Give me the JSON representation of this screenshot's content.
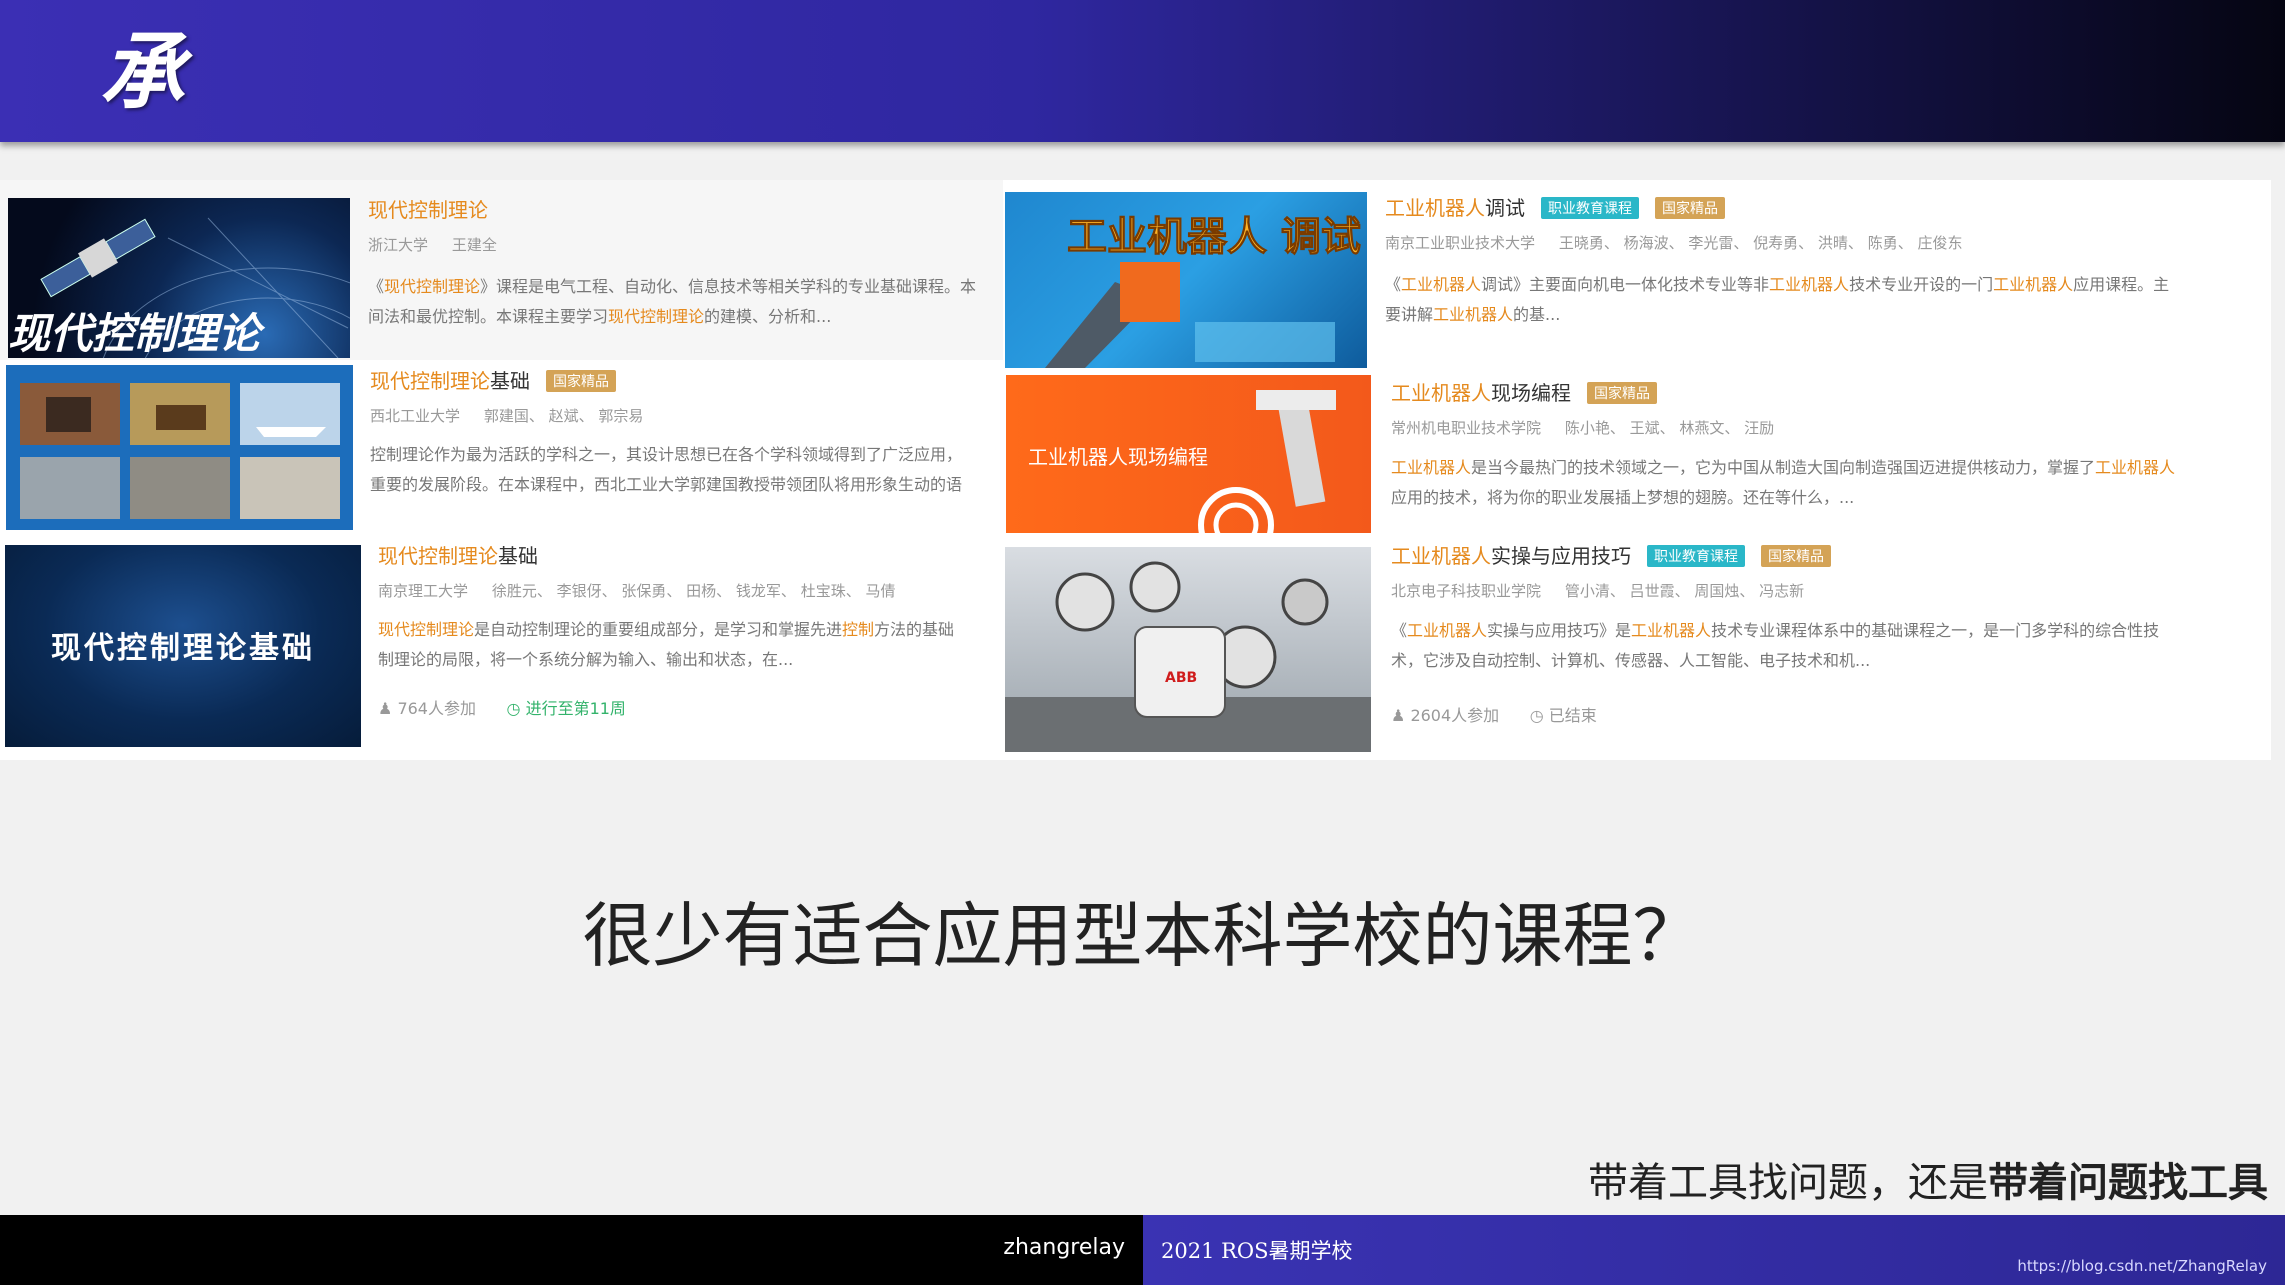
{
  "header": {
    "title": "承"
  },
  "courses_left": [
    {
      "title_hl": "现代控制理论",
      "title_rest": "",
      "tags": [],
      "school": "浙江大学",
      "teachers": "王建全",
      "desc": [
        {
          "t": "《"
        },
        {
          "t": "现代控制理论",
          "h": true
        },
        {
          "t": "》课程是电气工程、自动化、信息技术等相关学科的专业基础课程。本"
        },
        {
          "t": "\n"
        },
        {
          "t": "间法和最优控制。本课程主要学习"
        },
        {
          "t": "现代控制理论",
          "h": true
        },
        {
          "t": "的建模、分析和..."
        }
      ],
      "thumb_text": "现代控制理论"
    },
    {
      "title_hl": "现代控制理论",
      "title_rest": "基础",
      "tags": [
        "国家精品"
      ],
      "school": "西北工业大学",
      "teachers": "郭建国、 赵斌、 郭宗易",
      "desc": [
        {
          "t": "控制理论作为最为活跃的学科之一，其设计思想已在各个学科领域得到了广泛应用，"
        },
        {
          "t": "\n"
        },
        {
          "t": "重要的发展阶段。在本课程中，西北工业大学郭建国教授带领团队将用形象生动的语"
        }
      ]
    },
    {
      "title_hl": "现代控制理论",
      "title_rest": "基础",
      "tags": [],
      "school": "南京理工大学",
      "teachers": "徐胜元、 李银伢、 张保勇、 田杨、 钱龙军、 杜宝珠、 马倩",
      "desc": [
        {
          "t": "现代控制理论",
          "h": true
        },
        {
          "t": "是自动控制理论的重要组成部分，是学习和掌握先进"
        },
        {
          "t": "控制",
          "h": true
        },
        {
          "t": "方法的基础"
        },
        {
          "t": "\n"
        },
        {
          "t": "制理论的局限，将一个系统分解为输入、输出和状态，在..."
        }
      ],
      "thumb_text": "现代控制理论基础",
      "participants": "764人参加",
      "status": "进行至第11周"
    }
  ],
  "courses_right": [
    {
      "title_hl": "工业机器人",
      "title_rest": "调试",
      "tags": [
        "职业教育课程",
        "国家精品"
      ],
      "school": "南京工业职业技术大学",
      "teachers": "王晓勇、 杨海波、 李光雷、 倪寿勇、 洪晴、 陈勇、 庄俊东",
      "desc": [
        {
          "t": "《"
        },
        {
          "t": "工业机器人",
          "h": true
        },
        {
          "t": "调试》主要面向机电一体化技术专业等非"
        },
        {
          "t": "工业机器人",
          "h": true
        },
        {
          "t": "技术专业开设的一门"
        },
        {
          "t": "工业机器人",
          "h": true
        },
        {
          "t": "应用课程。主"
        },
        {
          "t": "\n"
        },
        {
          "t": "要讲解"
        },
        {
          "t": "工业机器人",
          "h": true
        },
        {
          "t": "的基..."
        }
      ],
      "thumb_text": "工业机器人 调试"
    },
    {
      "title_hl": "工业机器人",
      "title_rest": "现场编程",
      "tags": [
        "国家精品"
      ],
      "school": "常州机电职业技术学院",
      "teachers": "陈小艳、 王斌、 林燕文、 汪励",
      "desc": [
        {
          "t": "工业机器人",
          "h": true
        },
        {
          "t": "是当今最热门的技术领域之一，它为中国从制造大国向制造强国迈进提供核动力，掌握了"
        },
        {
          "t": "工业机器人",
          "h": true
        },
        {
          "t": "\n"
        },
        {
          "t": "应用的技术，将为你的职业发展插上梦想的翅膀。还在等什么，..."
        }
      ],
      "thumb_text": "工业机器人现场编程"
    },
    {
      "title_hl": "工业机器人",
      "title_rest": "实操与应用技巧",
      "tags": [
        "职业教育课程",
        "国家精品"
      ],
      "school": "北京电子科技职业学院",
      "teachers": "管小清、 吕世霞、 周国烛、 冯志新",
      "desc": [
        {
          "t": "《"
        },
        {
          "t": "工业机器人",
          "h": true
        },
        {
          "t": "实操与应用技巧》是"
        },
        {
          "t": "工业机器人",
          "h": true
        },
        {
          "t": "技术专业课程体系中的基础课程之一，是一门多学科的综合性技"
        },
        {
          "t": "\n"
        },
        {
          "t": "术，它涉及自动控制、计算机、传感器、人工智能、电子技术和机..."
        }
      ],
      "thumb_text": "ABB",
      "participants": "2604人参加",
      "status": "已结束"
    }
  ],
  "question": "很少有适合应用型本科学校的课程？",
  "tagline": {
    "normal": "带着工具找问题，还是",
    "bold": "带着问题找工具"
  },
  "footer": {
    "author": "zhangrelay",
    "event": "2021 ROS暑期学校",
    "url": "https://blog.csdn.net/ZhangRelay"
  },
  "colors": {
    "highlight": "#e58a1e",
    "tag_gold": "#d4a356",
    "tag_teal": "#2ab7c8",
    "header_blue": "#2f27a0"
  }
}
